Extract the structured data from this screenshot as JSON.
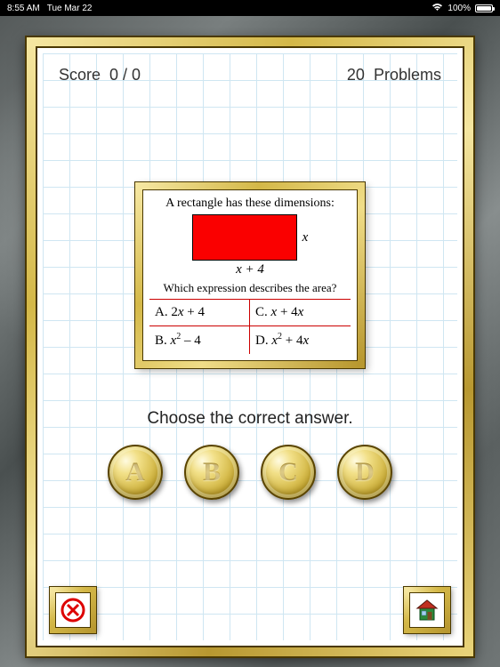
{
  "statusbar": {
    "time": "8:55 AM",
    "date": "Tue Mar 22",
    "wifi": "wifi-icon",
    "battery_pct": "100%"
  },
  "header": {
    "score_label": "Score",
    "score_value": "0 / 0",
    "problems_count": "20",
    "problems_label": "Problems"
  },
  "problem": {
    "line1": "A rectangle has these dimensions:",
    "dim_side": "x",
    "dim_bottom": "x + 4",
    "line2": "Which expression describes the area?",
    "choices": {
      "A": {
        "label": "A.",
        "expr_prefix": "2",
        "expr_var": "x",
        "expr_suffix": " + 4",
        "sup": ""
      },
      "B": {
        "label": "B.",
        "expr_prefix": "",
        "expr_var": "x",
        "expr_suffix": " – 4",
        "sup": "2"
      },
      "C": {
        "label": "C.",
        "expr_prefix": "",
        "expr_var": "x",
        "expr_suffix": " + 4",
        "sup": "",
        "tail_var": "x"
      },
      "D": {
        "label": "D.",
        "expr_prefix": "",
        "expr_var": "x",
        "expr_suffix": " + 4",
        "sup": "2",
        "tail_var": "x"
      }
    }
  },
  "instruction": "Choose the correct answer.",
  "buttons": {
    "A": "A",
    "B": "B",
    "C": "C",
    "D": "D"
  },
  "icons": {
    "close": "close-icon",
    "home": "home-icon"
  }
}
